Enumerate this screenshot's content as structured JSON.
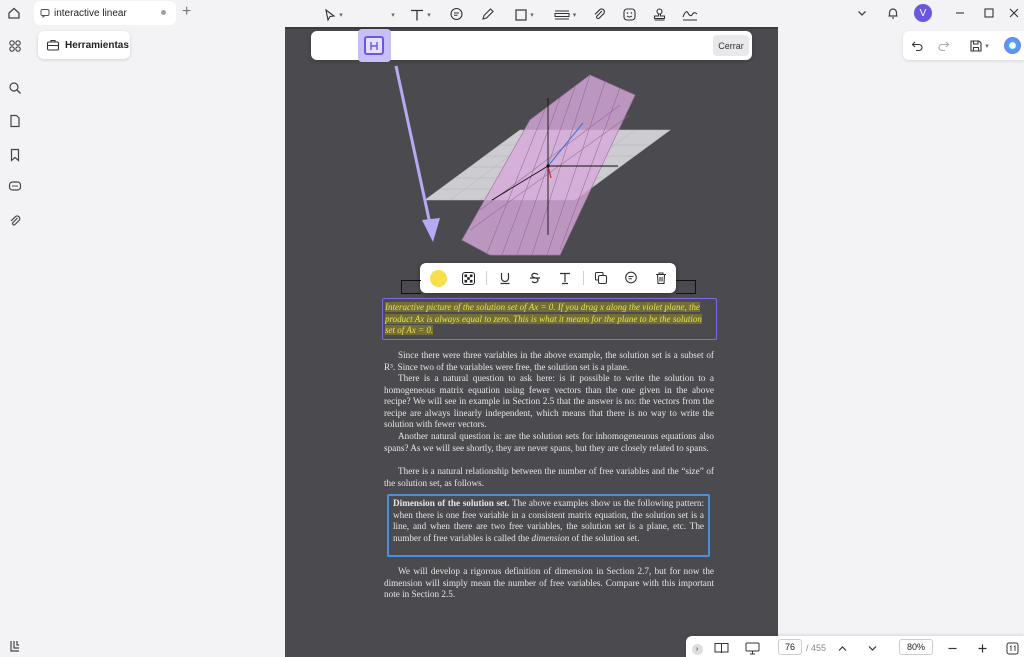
{
  "window": {
    "tab_title": "interactive linear",
    "avatar_letter": "V"
  },
  "left_panel": {
    "tools_label": "Herramientas"
  },
  "annotation_toolbar": {
    "close_label": "Cerrar",
    "tools": [
      "select-tool",
      "highlight-tool",
      "text-tool",
      "comment-tool",
      "pen-tool",
      "shape-tool",
      "measure-tool",
      "attachment-tool",
      "sticker-tool",
      "stamp-tool",
      "signature-tool"
    ]
  },
  "document": {
    "caption": "Interactive picture of the solution set of Ax = 0. If you drag x along the violet plane, the product Ax is always equal to zero. This is what it means for the plane to be the solution set of Ax = 0.",
    "paragraphs": [
      "Since there were three variables in the above example, the solution set is a subset of R³. Since two of the variables were free, the solution set is a plane.",
      "There is a natural question to ask here: is it possible to write the solution to a homogeneous matrix equation using fewer vectors than the one given in the above recipe? We will see in example in Section 2.5 that the answer is no: the vectors from the recipe are always linearly independent, which means that there is no way to write the solution with fewer vectors.",
      "Another natural question is: are the solution sets for inhomogeneuous equations also spans? As we will see shortly, they are never spans, but they are closely related to spans.",
      "There is a natural relationship between the number of free variables and the “size” of the solution set, as follows."
    ],
    "note_title": "Dimension of the solution set.",
    "note_body_1": "The above examples show us the following pattern: when there is one free variable in a consistent matrix equation, the solution set is a line, and when there are two free variables, the solution set is a plane, etc. The number of free variables is called the",
    "note_emph": "dimension",
    "note_body_2": "of the solution set.",
    "final_paragraph": "We will develop a rigorous definition of dimension in Section 2.7, but for now the dimension will simply mean the number of free variables. Compare with this important note in Section 2.5."
  },
  "status_bar": {
    "current_page": "76",
    "total_pages": "/ 455",
    "zoom": "80%"
  },
  "colors": {
    "accent": "#6a57e0",
    "highlight_yellow": "#f7e04a",
    "doc_background": "#4b4b4f"
  }
}
